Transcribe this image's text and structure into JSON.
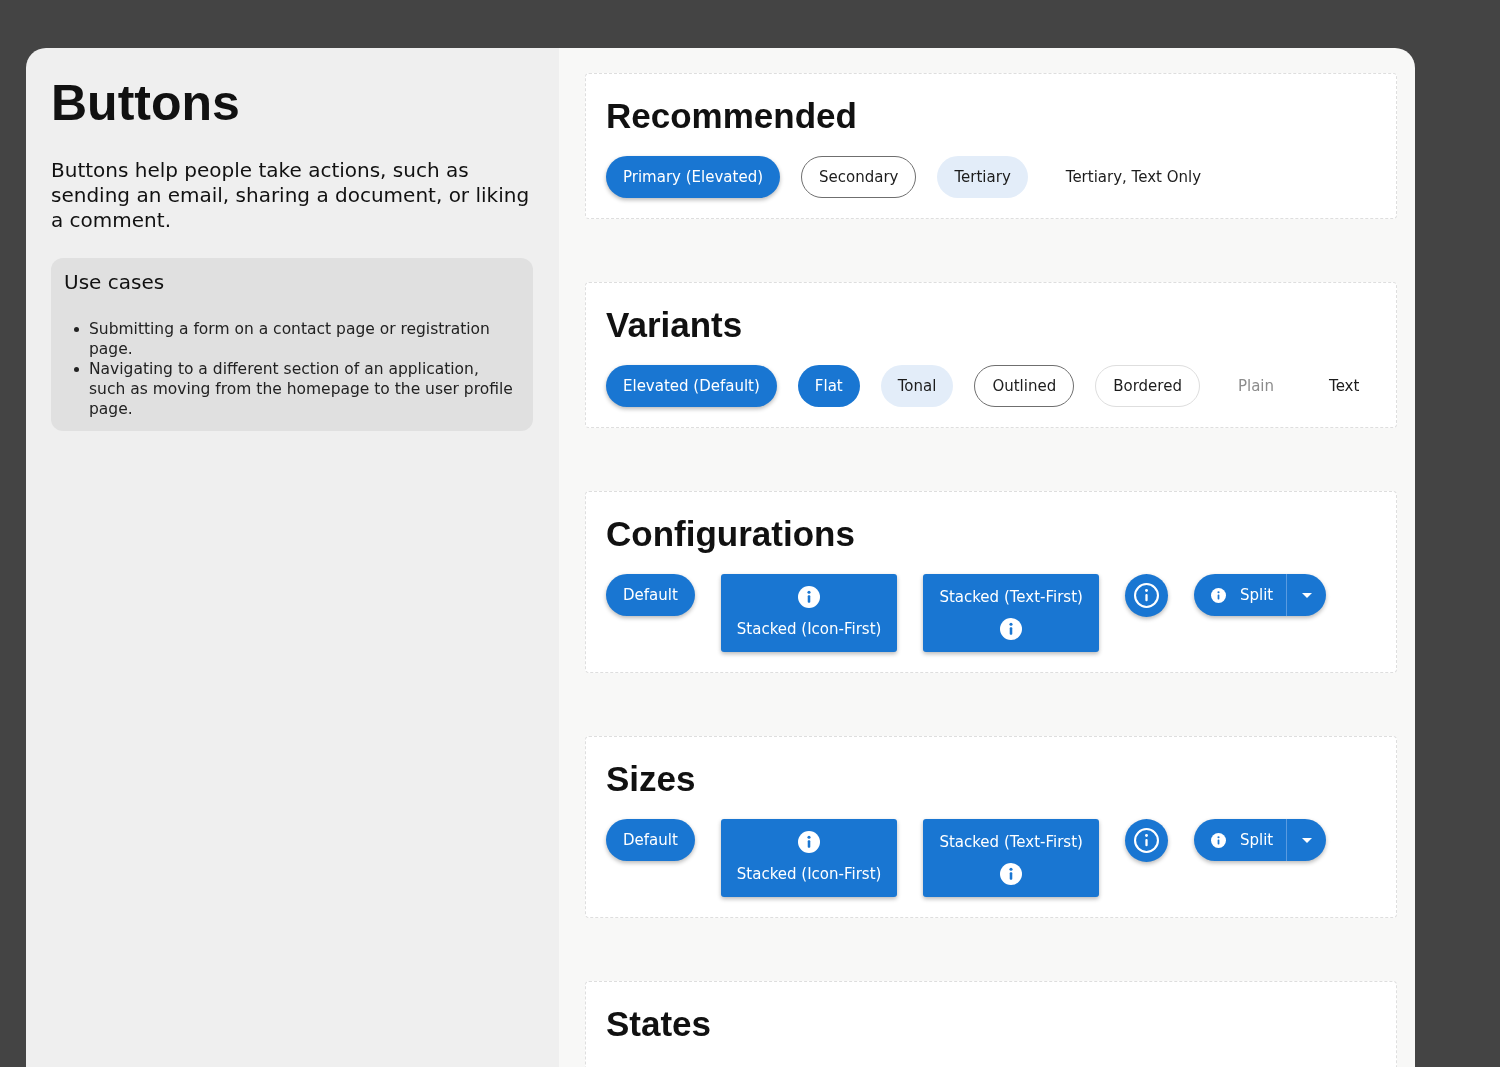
{
  "page": {
    "title": "Buttons",
    "description": "Buttons help people take actions, such as sending an email, sharing a document, or liking a comment.",
    "use_cases": {
      "title": "Use cases",
      "items": [
        "Submitting a form on a contact page or registration page.",
        "Navigating to a different section of an application, such as moving from the homepage to the user profile page."
      ]
    }
  },
  "sections": [
    {
      "title": "Recommended",
      "buttons": [
        {
          "kind": "elevated",
          "label": "Primary (Elevated)"
        },
        {
          "kind": "outlined",
          "label": "Secondary"
        },
        {
          "kind": "tonal",
          "label": "Tertiary"
        },
        {
          "kind": "text",
          "label": "Tertiary, Text Only"
        }
      ]
    },
    {
      "title": "Variants",
      "buttons": [
        {
          "kind": "elevated",
          "label": "Elevated (Default)"
        },
        {
          "kind": "flat",
          "label": "Flat"
        },
        {
          "kind": "tonal",
          "label": "Tonal"
        },
        {
          "kind": "outlined",
          "label": "Outlined"
        },
        {
          "kind": "bordered",
          "label": "Bordered"
        },
        {
          "kind": "plain",
          "label": "Plain"
        },
        {
          "kind": "text",
          "label": "Text"
        }
      ]
    },
    {
      "title": "Configurations",
      "buttons": [
        {
          "kind": "elevated",
          "label": "Default"
        },
        {
          "kind": "iconstack",
          "label": "Stacked (Icon-First)"
        },
        {
          "kind": "textstack",
          "label": "Stacked (Text-First)"
        },
        {
          "kind": "icon"
        },
        {
          "kind": "split",
          "label": "Split"
        }
      ]
    },
    {
      "title": "Sizes",
      "buttons": [
        {
          "kind": "elevated",
          "label": "Default"
        },
        {
          "kind": "iconstack",
          "label": "Stacked (Icon-First)"
        },
        {
          "kind": "textstack",
          "label": "Stacked (Text-First)"
        },
        {
          "kind": "icon"
        },
        {
          "kind": "split",
          "label": "Split"
        }
      ]
    },
    {
      "title": "States"
    }
  ]
}
